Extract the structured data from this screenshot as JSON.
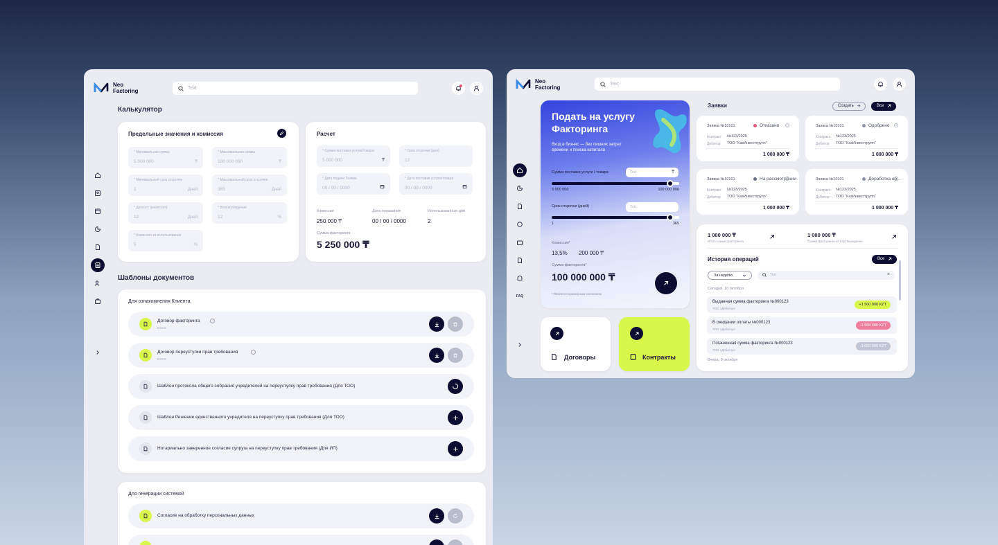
{
  "brand": {
    "line1": "Neo",
    "line2": "Factoring"
  },
  "left": {
    "search_placeholder": "Text",
    "calc_title": "Калькулятор",
    "limits": {
      "title": "Предельные значения и комиссия",
      "fields": [
        {
          "label": "* Минимальная сумма",
          "value": "5 000 000",
          "unit": "₸"
        },
        {
          "label": "* Максимальная сумма",
          "value": "100 000 000",
          "unit": "₸"
        },
        {
          "label": "* Минимальный срок отсрочки",
          "value": "1",
          "unit": "Дней"
        },
        {
          "label": "* Максимальный срок отсрочки",
          "value": "365",
          "unit": "Дней"
        },
        {
          "label": "* Дисконт (комиссия)",
          "value": "12",
          "unit": "Дней"
        },
        {
          "label": "* Вознаграждение",
          "value": "12",
          "unit": "%"
        },
        {
          "label": "* Комиссия за использование",
          "value": "5",
          "unit": "%"
        }
      ]
    },
    "calc": {
      "title": "Расчет",
      "fields": [
        {
          "label": "* Сумма поставки услуги/товара",
          "value": "5 000 000",
          "unit": "₸"
        },
        {
          "label": "* Срок отсрочки (дни)",
          "value": "12",
          "unit": ""
        },
        {
          "label": "* Дата подачи Заявки",
          "value": "00 / 00 / 0000",
          "unit": ""
        },
        {
          "label": "* Дата поставки услуги/товара",
          "value": "00 / 00 / 0000",
          "unit": ""
        }
      ],
      "k1": "Комиссия",
      "v1": "250 000 ₸",
      "k2": "Дата погашения",
      "v2": "00 / 00 / 0000",
      "k3": "Использованные дни",
      "v3": "2",
      "sum_label": "Сумма факторинга",
      "sum_value": "5 250 000 ₸"
    },
    "templates_title": "Шаблоны документов",
    "client_docs": {
      "title": "Для ознакомления Клиента",
      "items": [
        {
          "name": "Договор факторинга",
          "sub": "DOCX"
        },
        {
          "name": "Договор переуступки прав требования",
          "sub": "DOCX"
        },
        {
          "name": "Шаблон протокола общего собрания учредителей на переуступку прав требования (Для ТОО)",
          "sub": ""
        },
        {
          "name": "Шаблон Решение единственного учредителя на переуступку прав требования (Для ТОО)",
          "sub": ""
        },
        {
          "name": "Нотариально заверенное согласие супруга на переуступку прав требования (Для ИП)",
          "sub": ""
        }
      ]
    },
    "system_docs": {
      "title": "Для генерации системой",
      "items": [
        {
          "name": "Согласие на обработку персональных данных",
          "sub": ""
        }
      ]
    }
  },
  "right": {
    "search_placeholder": "Text",
    "hero": {
      "title": "Подать на услугу Факторинга",
      "subtitle": "Вход в бизнес — без лишних затрат времени и поиска капитала",
      "s1_label": "Сумма поставки услуги / товара",
      "s1_placeholder": "Text",
      "s1_min": "5 000 000",
      "s1_max": "100 000 000",
      "s1_level": 0.93,
      "s2_label": "Срок отсрочки (дней)",
      "s2_placeholder": "Text",
      "s2_min": "1",
      "s2_max": "365",
      "s2_level": 0.93,
      "comm_label": "Комиссия*",
      "comm_pct": "13,5%",
      "comm_val": "200 000 ₸",
      "sum_label": "Сумма факторинга*",
      "sum_value": "100 000 000 ₸",
      "note": "* Является примерным значением"
    },
    "tiles": {
      "contracts": "Договоры",
      "contracts2": "Контракты"
    },
    "apps": {
      "title": "Заявки",
      "create": "Создать",
      "all": "Все",
      "cards": [
        {
          "id": "Заявка №10101",
          "status": "Отказано",
          "dot": "#e8577e",
          "k1": "Контракт",
          "v1": "№123/2025",
          "k2": "Дебитор",
          "v2": "ТОО \"КазИнвестгрупп\"",
          "sum": "1 000 000 ₸"
        },
        {
          "id": "Заявка №10101",
          "status": "Одобрено",
          "dot": "#8e92a8",
          "k1": "Контракт",
          "v1": "№123/2025",
          "k2": "Дебитор",
          "v2": "ТОО \"КазИнвестгрупп\"",
          "sum": "1 000 000 ₸"
        },
        {
          "id": "Заявка №10101",
          "status": "На рассмотрении",
          "dot": "#6b6f8a",
          "k1": "Контракт",
          "v1": "№123/2025",
          "k2": "Дебитор",
          "v2": "ТОО \"КазИнвестгрупп\"",
          "sum": "1 000 000 ₸"
        },
        {
          "id": "Заявка №10101",
          "status": "Доработка ор...",
          "dot": "#8e92a8",
          "k1": "Контракт",
          "v1": "№123/2025",
          "k2": "Дебитор",
          "v2": "ТОО \"КазИнвестгрупп\"",
          "sum": "1 000 000 ₸"
        }
      ]
    },
    "history": {
      "t1": "1 000 000 ₸",
      "t1s": "Итого сумма факторинга",
      "t2": "1 000 000 ₸",
      "t2s": "Сумма факторинга на подтверждении",
      "title": "История операций",
      "all": "Все",
      "period": "За неделю",
      "search_placeholder": "Text",
      "today": "Сегодня, 10 октября",
      "yesterday": "Вчера, 9 октября",
      "ops": [
        {
          "t": "Выданная сумма факторинга №000123",
          "s": "ТОО «Дебитор»",
          "amount": "+1 500 000 KZT",
          "bg": "#d7f74a",
          "fg": "#2b2b4a"
        },
        {
          "t": "В ожидании оплаты №000123",
          "s": "ТОО «Дебитор»",
          "amount": "-1 500 000 KZT",
          "bg": "#ee7e9c",
          "fg": "#ffffff"
        },
        {
          "t": "Погашенная сумма факторинга №000123",
          "s": "ТОО «Дебитор»",
          "amount": "-1 000 000 KZT",
          "bg": "#c2c5d6",
          "fg": "#ffffff"
        }
      ]
    },
    "nav_faq": "FAQ"
  },
  "colors": {
    "accent": "#d7f74a",
    "dark": "#0c0c33",
    "hero_start": "#3b4de0"
  }
}
